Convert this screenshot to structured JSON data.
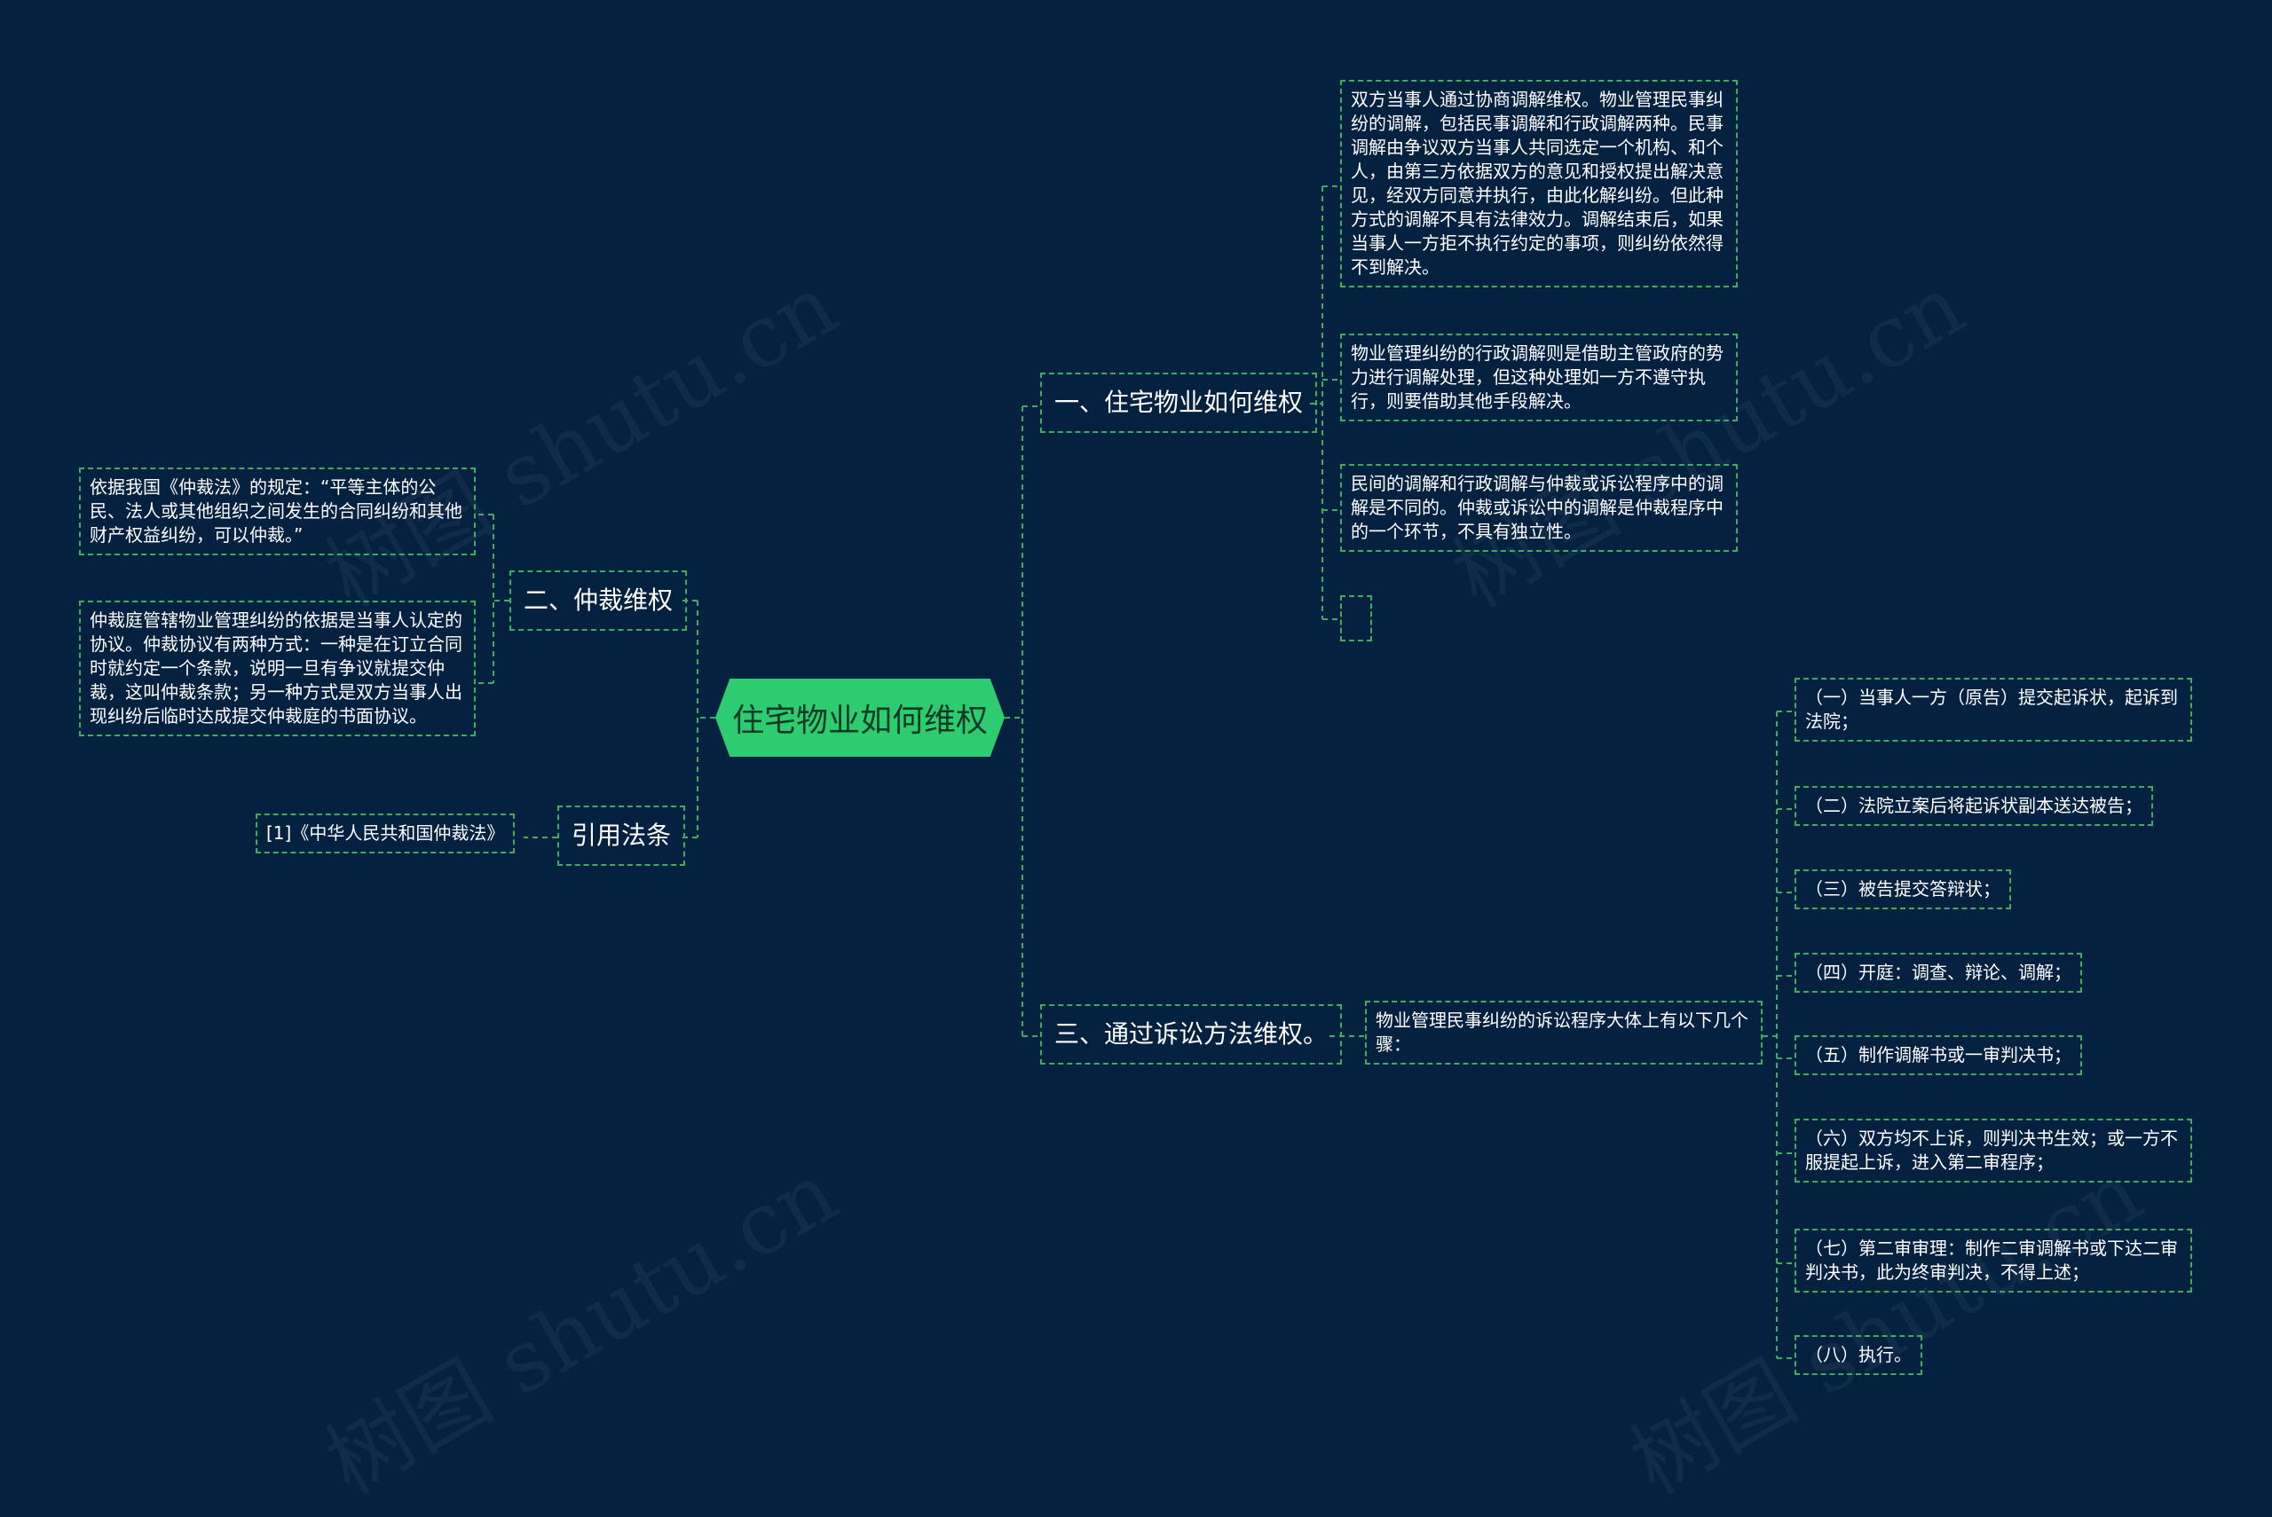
{
  "colors": {
    "background": "#04213f",
    "edge": "#3fae5c",
    "root_fill": "#2ecc71",
    "text": "#ffffff"
  },
  "watermark": "树图 shutu.cn",
  "root": {
    "label": "住宅物业如何维权"
  },
  "branches": {
    "b1": {
      "label": "一、住宅物业如何维权",
      "items": [
        "双方当事人通过协商调解维权。物业管理民事纠纷的调解，包括民事调解和行政调解两种。民事调解由争议双方当事人共同选定一个机构、和个人，由第三方依据双方的意见和授权提出解决意见，经双方同意并执行，由此化解纠纷。但此种方式的调解不具有法律效力。调解结束后，如果当事人一方拒不执行约定的事项，则纠纷依然得不到解决。",
        "物业管理纠纷的行政调解则是借助主管政府的势力进行调解处理，但这种处理如一方不遵守执行，则要借助其他手段解决。",
        "民间的调解和行政调解与仲裁或诉讼程序中的调解是不同的。仲裁或诉讼中的调解是仲裁程序中的一个环节，不具有独立性。",
        ""
      ]
    },
    "b2": {
      "label": "二、仲裁维权",
      "items": [
        "依据我国《仲裁法》的规定：“平等主体的公民、法人或其他组织之间发生的合同纠纷和其他财产权益纠纷，可以仲裁。”",
        "仲裁庭管辖物业管理纠纷的依据是当事人认定的协议。仲裁协议有两种方式：一种是在订立合同时就约定一个条款，说明一旦有争议就提交仲裁，这叫仲裁条款；另一种方式是双方当事人出现纠纷后临时达成提交仲裁庭的书面协议。"
      ]
    },
    "b3": {
      "label": "引用法条",
      "items": [
        "[1]《中华人民共和国仲裁法》"
      ]
    },
    "b4": {
      "label": "三、通过诉讼方法维权。",
      "mid": "物业管理民事纠纷的诉讼程序大体上有以下几个骤：",
      "steps": [
        "（一）当事人一方（原告）提交起诉状，起诉到法院；",
        "（二）法院立案后将起诉状副本送达被告；",
        "（三）被告提交答辩状；",
        "（四）开庭：调查、辩论、调解；",
        "（五）制作调解书或一审判决书；",
        "（六）双方均不上诉，则判决书生效；或一方不服提起上诉，进入第二审程序；",
        "（七）第二审审理：制作二审调解书或下达二审判决书，此为终审判决，不得上述；",
        "（八）执行。"
      ]
    }
  }
}
